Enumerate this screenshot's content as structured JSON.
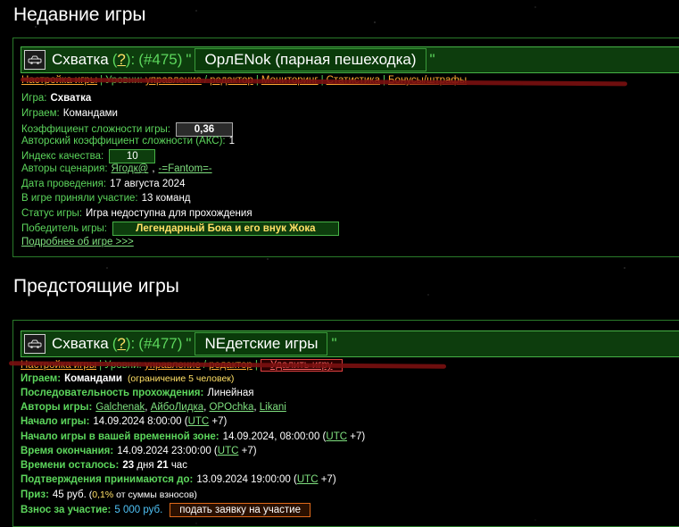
{
  "recent_section": {
    "title": "Недавние игры"
  },
  "upcoming_section": {
    "title": "Предстоящие игры"
  },
  "game1": {
    "type": "Схватка",
    "help": "?",
    "number": "(#475)",
    "name": "OpлENok (парная пешеходка)",
    "links": {
      "setup": "Настройка игры",
      "levels_prefix": "Уровни:",
      "control": "управление",
      "editor": "редактор",
      "monitoring": "Мониторинг",
      "stats": "Статистика",
      "bonuses": "Бонусы/штрафы"
    },
    "game_label": "Игра:",
    "game_value": "Схватка",
    "play_label": "Играем:",
    "play_value": "Командами",
    "difficulty_label": "Коэффициент сложности игры:",
    "difficulty_value": "0,36",
    "author_diff_label": "Авторский коэффициент сложности (АКС):",
    "author_diff_value": "1",
    "quality_label": "Индекс качества:",
    "quality_value": "10",
    "authors_label": "Авторы сценария:",
    "author1": "Ягодк@",
    "author_sep": ",",
    "author2": "-=Fantom=-",
    "date_label": "Дата проведения:",
    "date_value": "17 августа 2024",
    "participants_label": "В игре приняли участие:",
    "participants_value": "13 команд",
    "status_label": "Статус игры:",
    "status_value": "Игра недоступна для прохождения",
    "winners_label": "Победитель игры:",
    "winners_value": "Легендарный Бока и его внук Жока",
    "more_link": "Подробнее об игре >>>"
  },
  "game2": {
    "type": "Схватка",
    "help": "?",
    "number": "(#477)",
    "name": "NEдетские игры",
    "links": {
      "setup": "Настройка игры",
      "levels_prefix": "Уровни:",
      "control": "управление",
      "editor": "редактор",
      "delete": "Удалить игру"
    },
    "play_label": "Играем:",
    "play_value": "Командами",
    "play_note": "(ограничение 5 человек)",
    "sequence_label": "Последовательность прохождения:",
    "sequence_value": "Линейная",
    "authors_label": "Авторы игры:",
    "authors": [
      "Galchenak",
      "АйбоЛидка",
      "OPOchka",
      "Likani"
    ],
    "start_label": "Начало игры:",
    "start_value": "14.09.2024 8:00:00 (",
    "start_tz": "UTC",
    "start_offset": "+7)",
    "start_local_label": "Начало игры в вашей временной зоне:",
    "start_local_value": "14.09.2024, 08:00:00 (",
    "start_local_tz": "UTC",
    "start_local_offset": "+7)",
    "end_label": "Время окончания:",
    "end_value": "14.09.2024 23:00:00 (",
    "end_tz": "UTC",
    "end_offset": "+7)",
    "remaining_label": "Времени осталось:",
    "remaining_days": "23",
    "remaining_days_unit": "дня",
    "remaining_hours": "21",
    "remaining_hours_unit": "час",
    "confirm_label": "Подтверждения принимаются до:",
    "confirm_value": "13.09.2024 19:00:00 (",
    "confirm_tz": "UTC",
    "confirm_offset": "+7)",
    "prize_label": "Приз:",
    "prize_value": "45 руб.",
    "prize_note_open": "(",
    "prize_percent": "0,1%",
    "prize_note_rest": "от суммы взносов)",
    "fee_label": "Взнос за участие:",
    "fee_value": "5 000 руб.",
    "apply_button": "подать заявку на участие"
  }
}
